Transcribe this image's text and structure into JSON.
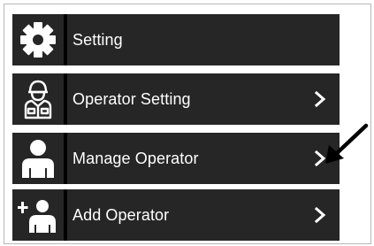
{
  "menu": {
    "items": [
      {
        "label": "Setting",
        "icon": "gear-icon",
        "has_chevron": false
      },
      {
        "label": "Operator Setting",
        "icon": "operator-vest-icon",
        "has_chevron": true
      },
      {
        "label": "Manage Operator",
        "icon": "person-icon",
        "has_chevron": true
      },
      {
        "label": "Add Operator",
        "icon": "add-person-icon",
        "has_chevron": true
      }
    ]
  },
  "annotation": {
    "icon": "pointer-arrow-icon"
  },
  "colors": {
    "row_background": "#262626",
    "divider": "#000000",
    "text": "#ffffff",
    "page_background": "#ffffff"
  }
}
